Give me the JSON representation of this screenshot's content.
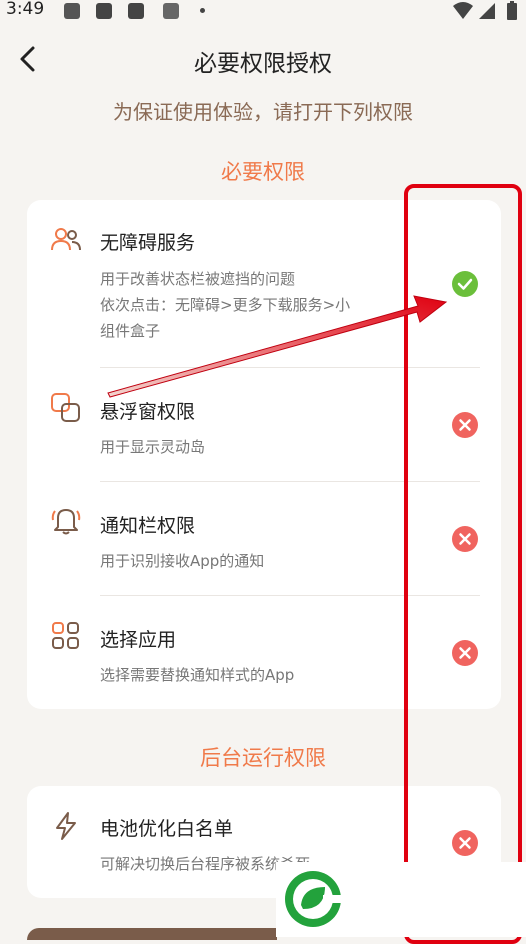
{
  "status_bar": {
    "time": "3:49"
  },
  "header": {
    "title": "必要权限授权"
  },
  "subtitle": "为保证使用体验，请打开下列权限",
  "sections": {
    "required": {
      "title": "必要权限",
      "items": [
        {
          "title": "无障碍服务",
          "desc": "用于改善状态栏被遮挡的问题\n依次点击：无障碍>更多下载服务>小\n组件盒子",
          "status": "granted"
        },
        {
          "title": "悬浮窗权限",
          "desc": "用于显示灵动岛",
          "status": "denied"
        },
        {
          "title": "通知栏权限",
          "desc": "用于识别接收App的通知",
          "status": "denied"
        },
        {
          "title": "选择应用",
          "desc": "选择需要替换通知样式的App",
          "status": "denied"
        }
      ]
    },
    "background": {
      "title": "后台运行权限",
      "items": [
        {
          "title": "电池优化白名单",
          "desc": "可解决切换后台程序被系统杀死",
          "status": "denied"
        }
      ]
    }
  },
  "colors": {
    "accent": "#f07a4a",
    "granted": "#6bbf3b",
    "denied": "#f0645f",
    "annotation": "#e00010"
  }
}
